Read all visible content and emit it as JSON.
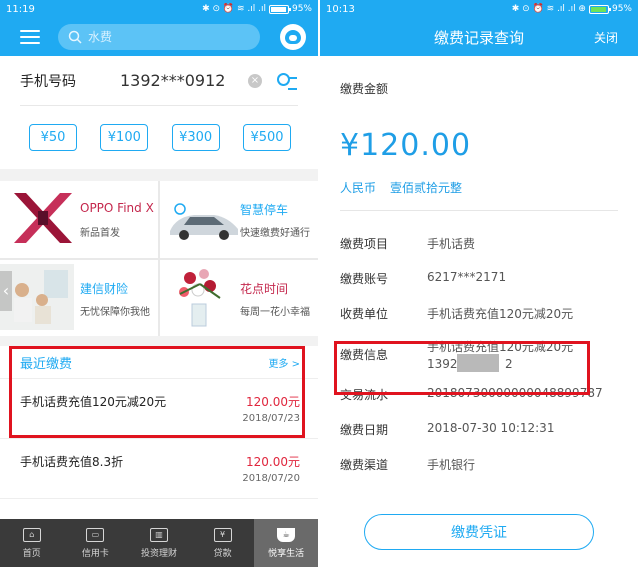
{
  "left": {
    "status": {
      "time": "11:19",
      "icons": "✱ ⊙ ⏰ ≋ .ıl .ıl",
      "battery": "95%"
    },
    "search": {
      "placeholder": "水费"
    },
    "phone": {
      "label": "手机号码",
      "value": "1392***0912",
      "clear": "×"
    },
    "amounts": [
      "¥50",
      "¥100",
      "¥300",
      "¥500"
    ],
    "promos": [
      {
        "title": "OPPO Find X",
        "subtitle": "新品首发",
        "title_color": "#c4284d"
      },
      {
        "title": "智慧停车",
        "subtitle": "快速缴费好通行",
        "title_color": "#1faaf2"
      },
      {
        "title": "建信财险",
        "subtitle": "无忧保障你我他",
        "title_color": "#1faaf2"
      },
      {
        "title": "花点时间",
        "subtitle": "每周一花小幸福",
        "title_color": "#c4284d"
      }
    ],
    "recent": {
      "title": "最近缴费",
      "more": "更多 >",
      "items": [
        {
          "name": "手机话费充值120元减20元",
          "amount": "120.00元",
          "date": "2018/07/23"
        },
        {
          "name": "手机话费充值8.3折",
          "amount": "120.00元",
          "date": "2018/07/20"
        }
      ]
    },
    "nav": [
      {
        "label": "首页",
        "icon": "home-icon",
        "glyph": "⌂"
      },
      {
        "label": "信用卡",
        "icon": "credit-card-icon",
        "glyph": "▭"
      },
      {
        "label": "投资理财",
        "icon": "chart-icon",
        "glyph": "▥"
      },
      {
        "label": "贷款",
        "icon": "yuan-coin-icon",
        "glyph": "¥"
      },
      {
        "label": "悦享生活",
        "icon": "coffee-cup-icon",
        "glyph": "☕"
      }
    ]
  },
  "right": {
    "status": {
      "time": "10:13",
      "icons": "✱ ⊙ ⏰ ≋ .ıl .ıl ⊕",
      "battery": "95%"
    },
    "title": "缴费记录查询",
    "close": "关闭",
    "amount_label": "缴费金额",
    "amount": "¥120.00",
    "currency": "人民币",
    "amount_words": "壹佰贰拾元整",
    "details": [
      {
        "label": "缴费项目",
        "value": "手机话费"
      },
      {
        "label": "缴费账号",
        "value": "6217***2171"
      },
      {
        "label": "收费单位",
        "value": "手机话费充值120元减20元"
      },
      {
        "label": "缴费信息",
        "value": "手机话费充值120元减20元",
        "value2": "1392",
        "value3": "2"
      },
      {
        "label": "交易流水",
        "value": "20180730000000048899787"
      },
      {
        "label": "缴费日期",
        "value": "2018-07-30 10:12:31"
      },
      {
        "label": "缴费渠道",
        "value": "手机银行"
      }
    ],
    "voucher": "缴费凭证"
  },
  "colors": {
    "primary": "#1faaf2",
    "amount_red": "#e0273e",
    "highlight_box": "#e0131f",
    "nav_bg": "#3a3a3a"
  }
}
